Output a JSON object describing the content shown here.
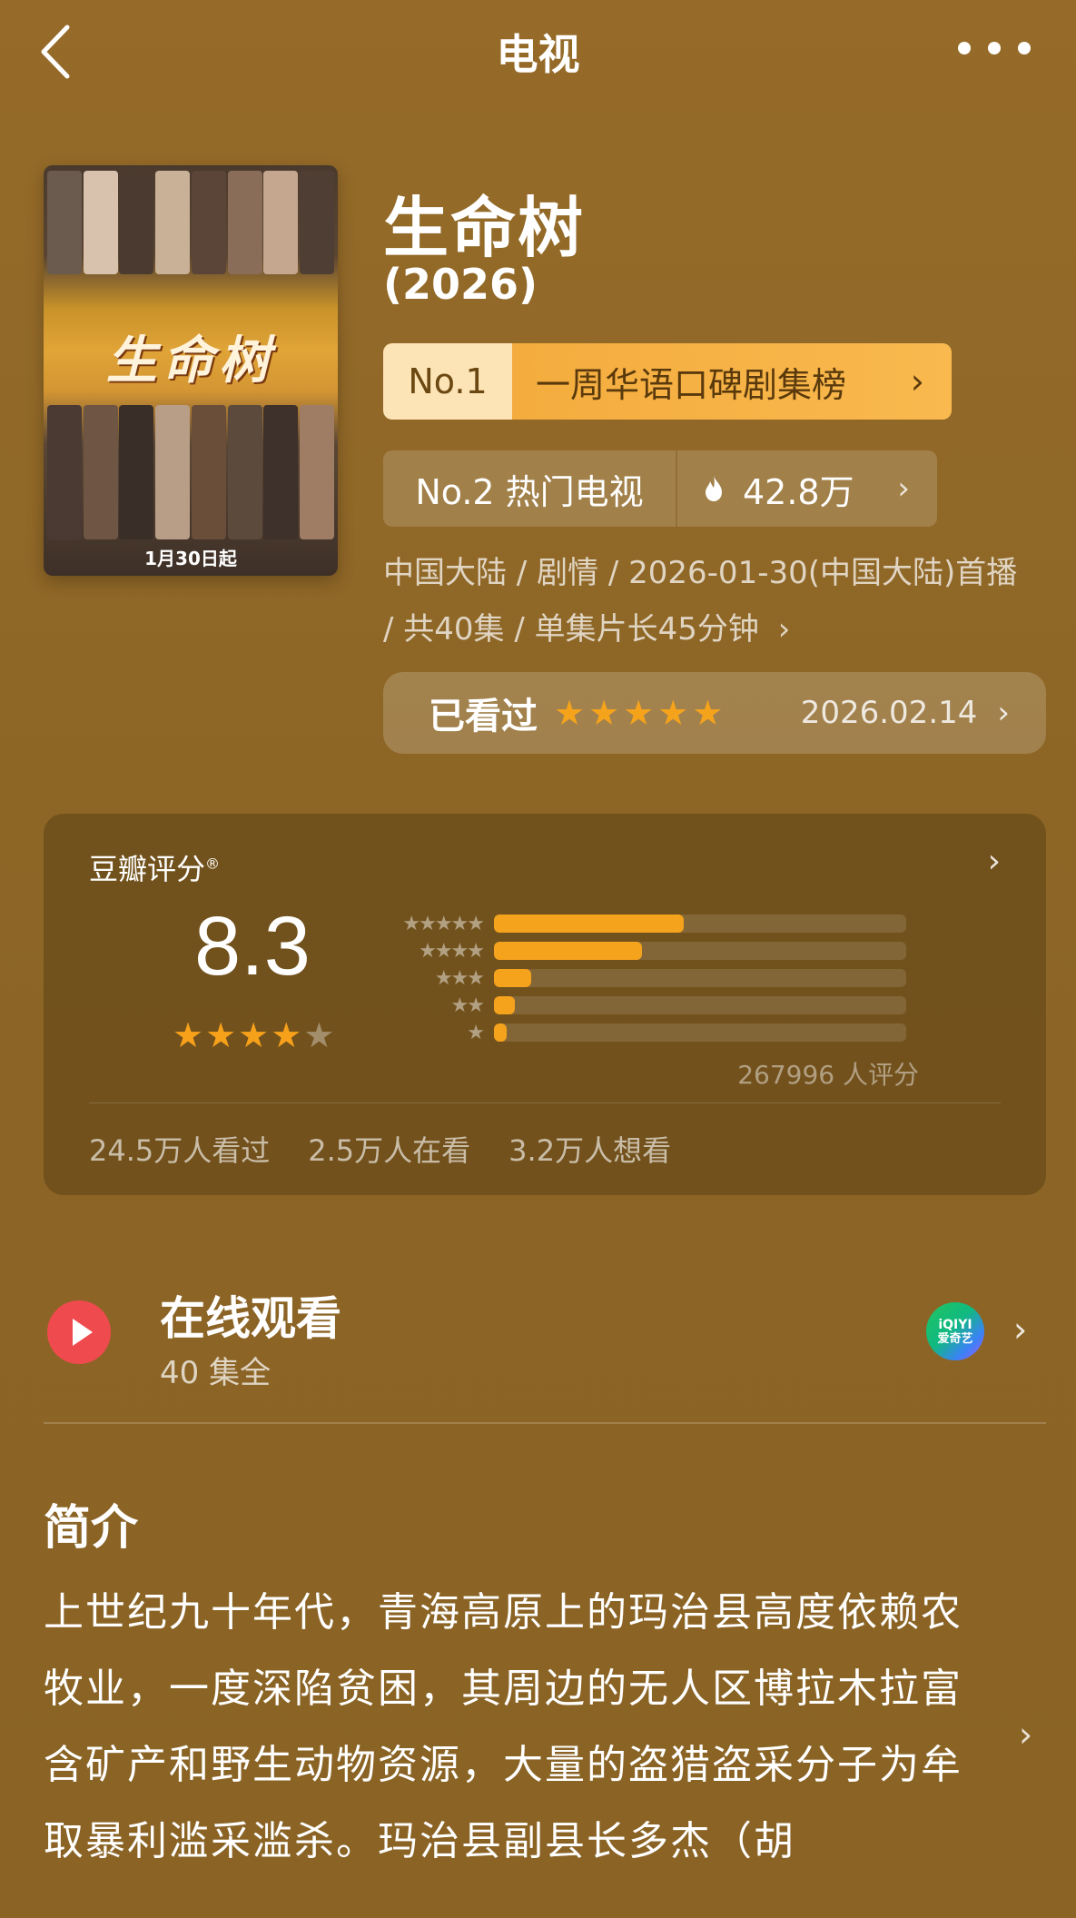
{
  "nav": {
    "title": "电视",
    "back_icon": "chevron-left-icon",
    "more_icon": "more-dots-icon"
  },
  "poster": {
    "logo_text": "生命树",
    "date_text": "1月30日起"
  },
  "show": {
    "title": "生命树",
    "year": "(2026)"
  },
  "rank_primary": {
    "number": "No.1",
    "label": "一周华语口碑剧集榜",
    "chevron": "›"
  },
  "rank_secondary": {
    "label": "No.2 热门电视",
    "heat": "42.8万",
    "chevron": "›"
  },
  "meta": {
    "line": "中国大陆 / 剧情 / 2026-01-30(中国大陆)首播 / 共40集 / 单集片长45分钟",
    "chevron": "›"
  },
  "watched": {
    "label": "已看过",
    "stars": 5,
    "date": "2026.02.14",
    "chevron": "›"
  },
  "rating": {
    "label": "豆瓣评分",
    "registered_mark": "®",
    "score": "8.3",
    "stars_filled": 4,
    "stars_total": 5,
    "distribution": [
      {
        "stars": "★★★★★",
        "fraction": 0.46
      },
      {
        "stars": "★★★★",
        "fraction": 0.36
      },
      {
        "stars": "★★★",
        "fraction": 0.09
      },
      {
        "stars": "★★",
        "fraction": 0.05
      },
      {
        "stars": "★",
        "fraction": 0.03
      }
    ],
    "count_text": "267996 人评分",
    "stats": [
      "24.5万人看过",
      "2.5万人在看",
      "3.2万人想看"
    ],
    "chevron": "›"
  },
  "online": {
    "title": "在线观看",
    "subtitle": "40 集全",
    "provider_line1": "iQIYI",
    "provider_line2": "爱奇艺",
    "chevron": "›"
  },
  "intro": {
    "title": "简介",
    "text": "上世纪九十年代，青海高原上的玛治县高度依赖农牧业，一度深陷贫困，其周边的无人区博拉木拉富含矿产和野生动物资源，大量的盗猎盗采分子为牟取暴利滥采滥杀。玛治县副县长多杰（胡",
    "chevron": "›"
  },
  "colors": {
    "background": "#8d6626",
    "accent_orange": "#f5a21c",
    "rank_badge": "#f4ac3e",
    "play_red": "#ef4a4d"
  }
}
